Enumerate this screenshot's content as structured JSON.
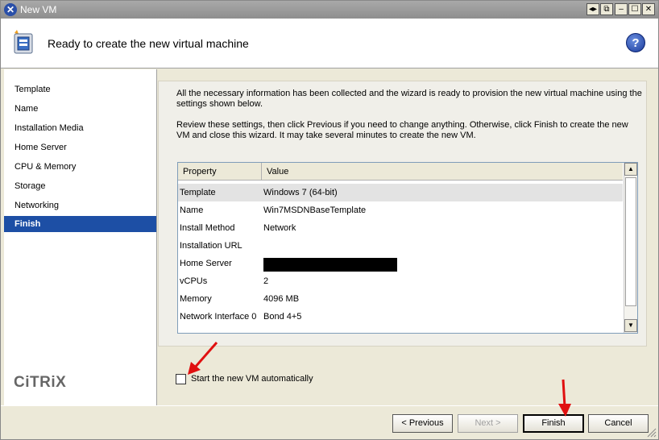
{
  "window": {
    "title": "New VM"
  },
  "header": {
    "title": "Ready to create the new virtual machine",
    "help": "?"
  },
  "sidebar": {
    "items": [
      {
        "label": "Template",
        "active": false
      },
      {
        "label": "Name",
        "active": false
      },
      {
        "label": "Installation Media",
        "active": false
      },
      {
        "label": "Home Server",
        "active": false
      },
      {
        "label": "CPU & Memory",
        "active": false
      },
      {
        "label": "Storage",
        "active": false
      },
      {
        "label": "Networking",
        "active": false
      },
      {
        "label": "Finish",
        "active": true
      }
    ],
    "logo": "CiTRiX"
  },
  "main": {
    "intro": "All the necessary information has been collected and the wizard is ready to provision the new virtual machine using the settings shown below.",
    "instructions": "Review these settings, then click Previous if you need to change anything. Otherwise, click Finish to create the new VM and close this wizard. It may take several minutes to create the new VM.",
    "grid": {
      "columns": [
        "Property",
        "Value"
      ],
      "rows": [
        {
          "property": "Template",
          "value": "Windows 7 (64-bit)"
        },
        {
          "property": "Name",
          "value": "Win7MSDNBaseTemplate"
        },
        {
          "property": "Install Method",
          "value": "Network"
        },
        {
          "property": "Installation URL",
          "value": ""
        },
        {
          "property": "Home Server",
          "value": "",
          "redacted": true
        },
        {
          "property": "vCPUs",
          "value": "2"
        },
        {
          "property": "Memory",
          "value": "4096 MB"
        },
        {
          "property": "Network Interface 0",
          "value": "Bond 4+5"
        }
      ]
    },
    "auto_start_label": "Start the new VM automatically",
    "auto_start_checked": false
  },
  "footer": {
    "previous_label": "< Previous",
    "next_label": "Next >",
    "finish_label": "Finish",
    "cancel_label": "Cancel"
  },
  "colors": {
    "selection": "#1d4fa5",
    "annotation_arrow": "#e01010"
  }
}
